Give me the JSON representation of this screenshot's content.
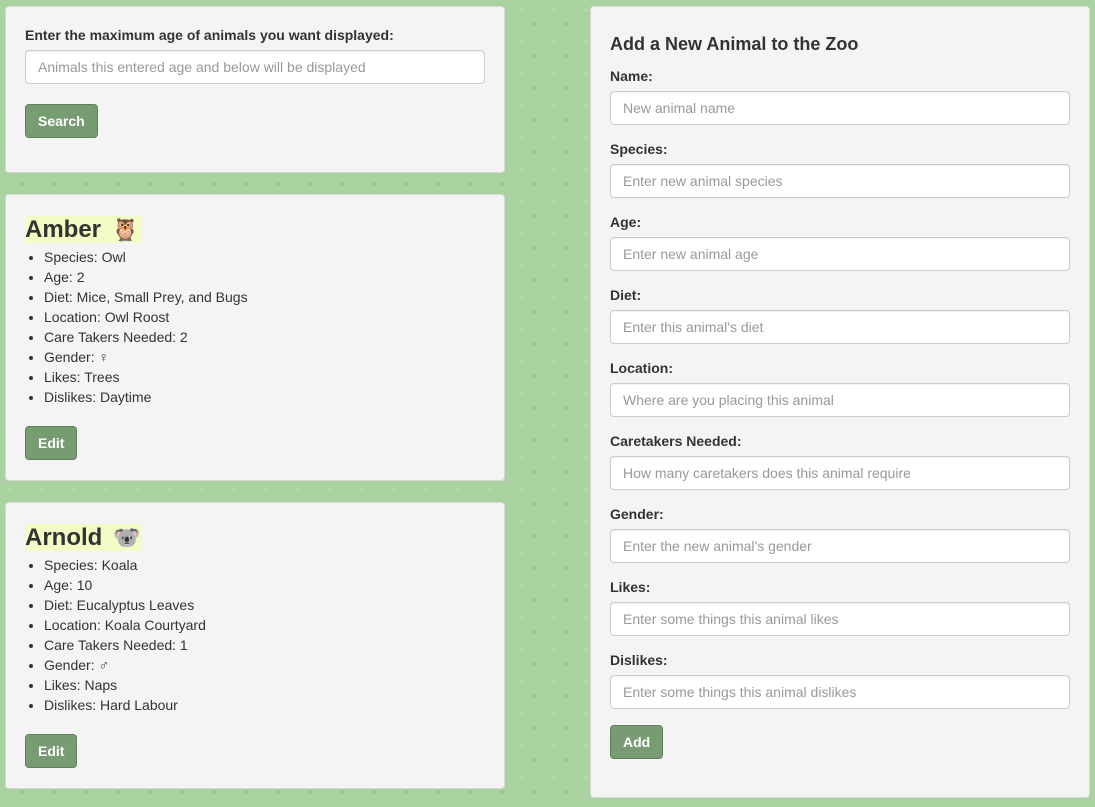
{
  "search": {
    "label": "Enter the maximum age of animals you want displayed:",
    "placeholder": "Animals this entered age and below will be displayed",
    "button": "Search"
  },
  "animals": [
    {
      "name": "Amber",
      "emoji": "🦉",
      "details": [
        "Species: Owl",
        "Age: 2",
        "Diet: Mice, Small Prey, and Bugs",
        "Location: Owl Roost",
        "Care Takers Needed: 2",
        "Gender: ♀",
        "Likes: Trees",
        "Dislikes: Daytime"
      ],
      "edit_label": "Edit"
    },
    {
      "name": "Arnold",
      "emoji": "🐨",
      "details": [
        "Species: Koala",
        "Age: 10",
        "Diet: Eucalyptus Leaves",
        "Location: Koala Courtyard",
        "Care Takers Needed: 1",
        "Gender: ♂",
        "Likes: Naps",
        "Dislikes: Hard Labour"
      ],
      "edit_label": "Edit"
    }
  ],
  "add_form": {
    "title": "Add a New Animal to the Zoo",
    "fields": [
      {
        "label": "Name:",
        "placeholder": "New animal name"
      },
      {
        "label": "Species:",
        "placeholder": "Enter new animal species"
      },
      {
        "label": "Age:",
        "placeholder": "Enter new animal age"
      },
      {
        "label": "Diet:",
        "placeholder": "Enter this animal's diet"
      },
      {
        "label": "Location:",
        "placeholder": "Where are you placing this animal"
      },
      {
        "label": "Caretakers Needed:",
        "placeholder": "How many caretakers does this animal require"
      },
      {
        "label": "Gender:",
        "placeholder": "Enter the new animal's gender"
      },
      {
        "label": "Likes:",
        "placeholder": "Enter some things this animal likes"
      },
      {
        "label": "Dislikes:",
        "placeholder": "Enter some things this animal dislikes"
      }
    ],
    "button": "Add"
  },
  "colors": {
    "background": "#a9d2a0",
    "panel": "#f4f4f4",
    "button": "#789c72",
    "name_highlight": "#f3fcc4"
  }
}
